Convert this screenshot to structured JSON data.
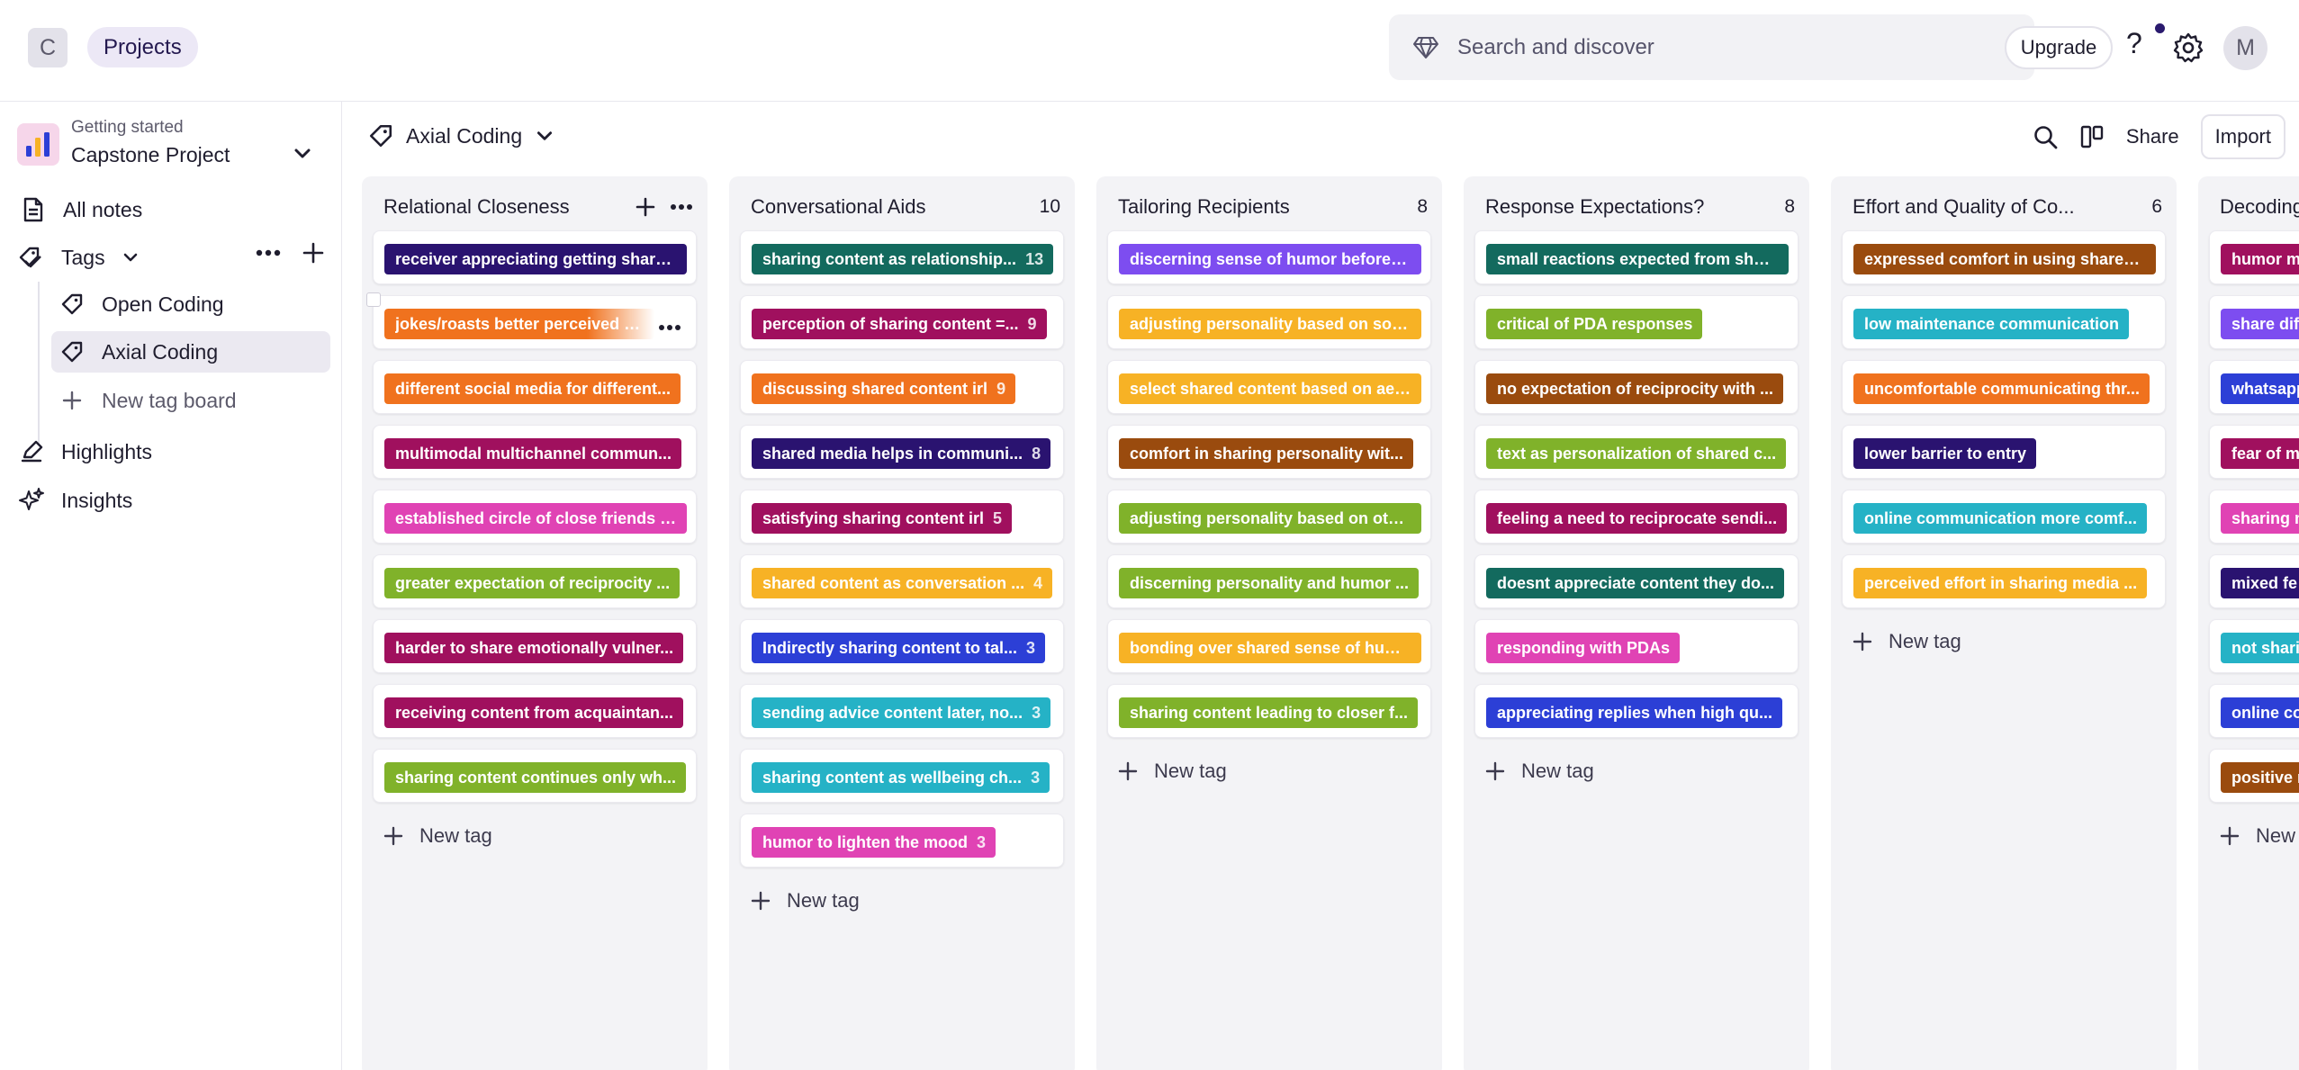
{
  "topbar": {
    "workspace_initial": "C",
    "projects_label": "Projects",
    "search_placeholder": "Search and discover",
    "upgrade_label": "Upgrade",
    "help_label": "?",
    "avatar_initial": "M"
  },
  "sidebar": {
    "project_sub": "Getting started",
    "project_name": "Capstone Project",
    "all_notes": "All notes",
    "tags": "Tags",
    "tag_boards": [
      "Open Coding",
      "Axial Coding"
    ],
    "new_tag_board": "New tag board",
    "highlights": "Highlights",
    "insights": "Insights"
  },
  "board": {
    "title": "Axial Coding",
    "share_label": "Share",
    "import_label": "Import"
  },
  "new_tag_label": "New tag",
  "columns": [
    {
      "title": "Relational Closeness",
      "count": "",
      "cards": [
        {
          "label": "receiver appreciating getting share...",
          "count": "",
          "color": "#2a1370"
        },
        {
          "label": "jokes/roasts better perceived whe",
          "count": "",
          "color": "#f0721e"
        },
        {
          "label": "different social media for different...",
          "count": "",
          "color": "#f0721e"
        },
        {
          "label": "multimodal multichannel commun...",
          "count": "",
          "color": "#a0105e"
        },
        {
          "label": "established circle of close friends t...",
          "count": "",
          "color": "#e043b4"
        },
        {
          "label": "greater expectation of reciprocity ...",
          "count": "",
          "color": "#80b22a"
        },
        {
          "label": "harder to share emotionally vulner...",
          "count": "",
          "color": "#a0105e"
        },
        {
          "label": "receiving content from acquaintan...",
          "count": "",
          "color": "#a0105e"
        },
        {
          "label": "sharing content continues only wh...",
          "count": "",
          "color": "#80b22a"
        }
      ]
    },
    {
      "title": "Conversational Aids",
      "count": "10",
      "cards": [
        {
          "label": "sharing content as relationship...",
          "count": "13",
          "color": "#136a5e"
        },
        {
          "label": "perception of sharing content =...",
          "count": "9",
          "color": "#a0105e"
        },
        {
          "label": "discussing shared content irl",
          "count": "9",
          "color": "#f0721e"
        },
        {
          "label": "shared media helps in communi...",
          "count": "8",
          "color": "#2a1370"
        },
        {
          "label": "satisfying sharing content irl",
          "count": "5",
          "color": "#a0105e"
        },
        {
          "label": "shared content as conversation ...",
          "count": "4",
          "color": "#f7b225"
        },
        {
          "label": "Indirectly sharing content to tal...",
          "count": "3",
          "color": "#2c3fd6"
        },
        {
          "label": "sending advice content later, no...",
          "count": "3",
          "color": "#25b2c6"
        },
        {
          "label": "sharing content as wellbeing ch...",
          "count": "3",
          "color": "#25b2c6"
        },
        {
          "label": "humor to lighten the mood",
          "count": "3",
          "color": "#e043b4"
        }
      ]
    },
    {
      "title": "Tailoring Recipients",
      "count": "8",
      "cards": [
        {
          "label": "discerning sense of humor beforeh...",
          "count": "",
          "color": "#7d4df0"
        },
        {
          "label": "adjusting personality based on soc...",
          "count": "",
          "color": "#f7b225"
        },
        {
          "label": "select shared content based on aes...",
          "count": "",
          "color": "#f7b225"
        },
        {
          "label": "comfort in sharing personality wit...",
          "count": "",
          "color": "#9a4b0e"
        },
        {
          "label": "adjusting personality based on oth...",
          "count": "",
          "color": "#80b22a"
        },
        {
          "label": "discerning personality and humor ...",
          "count": "",
          "color": "#80b22a"
        },
        {
          "label": "bonding over shared sense of humor",
          "count": "",
          "color": "#f7b225"
        },
        {
          "label": "sharing content leading to closer f...",
          "count": "",
          "color": "#80b22a"
        }
      ]
    },
    {
      "title": "Response Expectations?",
      "count": "8",
      "cards": [
        {
          "label": "small reactions expected from shar...",
          "count": "",
          "color": "#136a5e"
        },
        {
          "label": "critical of PDA responses",
          "count": "",
          "color": "#80b22a"
        },
        {
          "label": "no expectation of reciprocity with ...",
          "count": "",
          "color": "#9a4b0e"
        },
        {
          "label": "text as personalization of shared c...",
          "count": "",
          "color": "#80b22a"
        },
        {
          "label": "feeling a need to reciprocate sendi...",
          "count": "",
          "color": "#a0105e"
        },
        {
          "label": "doesnt appreciate content they do...",
          "count": "",
          "color": "#136a5e"
        },
        {
          "label": "responding with PDAs",
          "count": "",
          "color": "#e043b4"
        },
        {
          "label": "appreciating replies when high qu...",
          "count": "",
          "color": "#2c3fd6"
        }
      ]
    },
    {
      "title": "Effort and Quality of Co...",
      "count": "6",
      "cards": [
        {
          "label": "expressed comfort in using shared...",
          "count": "",
          "color": "#9a4b0e"
        },
        {
          "label": "low maintenance communication",
          "count": "",
          "color": "#25b2c6"
        },
        {
          "label": "uncomfortable communicating thr...",
          "count": "",
          "color": "#f0721e"
        },
        {
          "label": "lower barrier to entry",
          "count": "",
          "color": "#2a1370"
        },
        {
          "label": "online communication more comf...",
          "count": "",
          "color": "#25b2c6"
        },
        {
          "label": "perceived effort in sharing media ...",
          "count": "",
          "color": "#f7b225"
        }
      ]
    },
    {
      "title": "Decoding",
      "count": "",
      "cards": [
        {
          "label": "humor m",
          "count": "",
          "color": "#a0105e"
        },
        {
          "label": "share dif",
          "count": "",
          "color": "#7d4df0"
        },
        {
          "label": "whatsapp",
          "count": "",
          "color": "#2c3fd6"
        },
        {
          "label": "fear of m",
          "count": "",
          "color": "#a0105e"
        },
        {
          "label": "sharing m",
          "count": "",
          "color": "#e043b4"
        },
        {
          "label": "mixed fe",
          "count": "",
          "color": "#2a1370"
        },
        {
          "label": "not shari",
          "count": "",
          "color": "#25b2c6"
        },
        {
          "label": "online co",
          "count": "",
          "color": "#2c3fd6"
        },
        {
          "label": "positive r",
          "count": "",
          "color": "#9a4b0e"
        }
      ]
    }
  ]
}
